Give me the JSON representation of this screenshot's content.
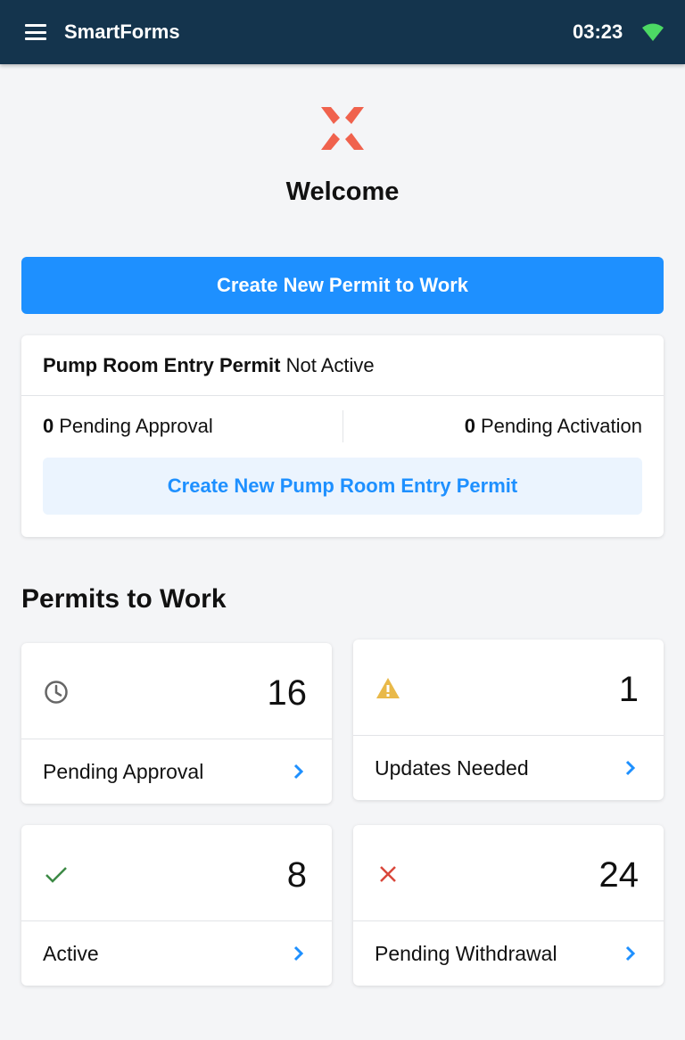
{
  "header": {
    "title": "SmartForms",
    "time": "03:23"
  },
  "welcome": "Welcome",
  "primary_button": "Create New Permit to Work",
  "pump_room": {
    "title": "Pump Room Entry Permit",
    "status": "Not Active",
    "pending_approval_count": "0",
    "pending_approval_label": "Pending Approval",
    "pending_activation_count": "0",
    "pending_activation_label": "Pending Activation",
    "button": "Create New Pump Room Entry Permit"
  },
  "section_title": "Permits to Work",
  "stats": [
    {
      "icon": "clock-icon",
      "count": "16",
      "label": "Pending Approval"
    },
    {
      "icon": "warning-icon",
      "count": "1",
      "label": "Updates Needed"
    },
    {
      "icon": "check-icon",
      "count": "8",
      "label": "Active"
    },
    {
      "icon": "close-icon",
      "count": "24",
      "label": "Pending Withdrawal"
    }
  ],
  "colors": {
    "topbar": "#14344d",
    "primary": "#1e90ff",
    "logo": "#f0624d",
    "warning": "#e9b949",
    "success": "#3c8a45",
    "danger": "#d9473b",
    "wifi": "#4cd964"
  }
}
